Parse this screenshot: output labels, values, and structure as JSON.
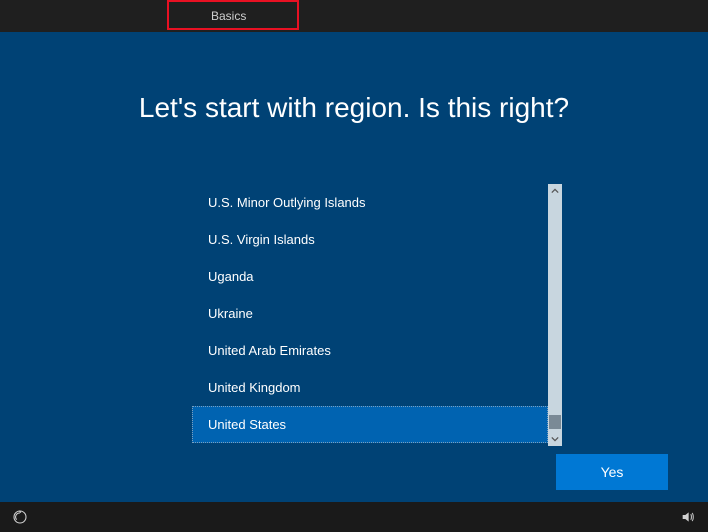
{
  "topbar": {
    "tab_label": "Basics"
  },
  "title": "Let's start with region. Is this right?",
  "regions": {
    "items": [
      {
        "label": "U.S. Minor Outlying Islands"
      },
      {
        "label": "U.S. Virgin Islands"
      },
      {
        "label": "Uganda"
      },
      {
        "label": "Ukraine"
      },
      {
        "label": "United Arab Emirates"
      },
      {
        "label": "United Kingdom"
      },
      {
        "label": "United States"
      }
    ],
    "selected_index": 6
  },
  "buttons": {
    "yes": "Yes"
  }
}
